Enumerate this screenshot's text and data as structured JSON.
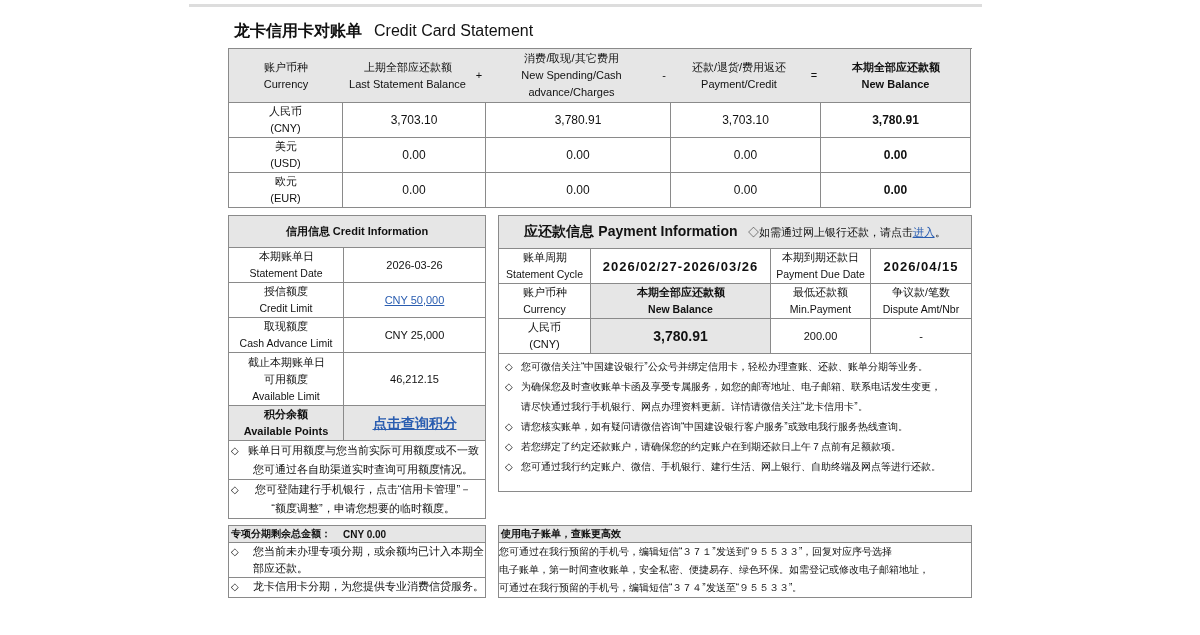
{
  "title": {
    "zh": "龙卡信用卡对账单",
    "en": "Credit Card Statement"
  },
  "summary": {
    "columns": [
      {
        "zh": "账户币种",
        "en": "Currency",
        "emphasis": false
      },
      {
        "zh": "上期全部应还款额",
        "en": "Last Statement Balance",
        "operator": "+",
        "emphasis": false
      },
      {
        "zh": "消费/取现/其它费用",
        "en": "New Spending/Cash advance/Charges",
        "operator": "-",
        "emphasis": false
      },
      {
        "zh": "还款/退货/费用返还",
        "en": "Payment/Credit",
        "operator": "=",
        "emphasis": false
      },
      {
        "zh": "本期全部应还款额",
        "en": "New Balance",
        "emphasis": true
      }
    ],
    "rows": [
      {
        "currency": "人民币",
        "code": "(CNY)",
        "values": [
          "3,703.10",
          "3,780.91",
          "3,703.10",
          "3,780.91"
        ]
      },
      {
        "currency": "美元",
        "code": "(USD)",
        "values": [
          "0.00",
          "0.00",
          "0.00",
          "0.00"
        ]
      },
      {
        "currency": "欧元",
        "code": "(EUR)",
        "values": [
          "0.00",
          "0.00",
          "0.00",
          "0.00"
        ]
      }
    ]
  },
  "credit": {
    "title": "信用信息 Credit Information",
    "rows": [
      {
        "label": [
          "本期账单日",
          "Statement Date"
        ],
        "value": "2026-03-26",
        "link": false,
        "highlight": false
      },
      {
        "label": [
          "授信额度",
          "Credit Limit"
        ],
        "value": "CNY 50,000",
        "link": true,
        "highlight": false
      },
      {
        "label": [
          "取现额度",
          "Cash Advance Limit"
        ],
        "value": "CNY 25,000",
        "link": false,
        "highlight": false
      },
      {
        "label": [
          "截止本期账单日",
          "可用额度",
          "Available Limit"
        ],
        "value": "46,212.15",
        "link": false,
        "highlight": false
      },
      {
        "label": [
          "积分余额",
          "Available Points"
        ],
        "value": "点击查询积分",
        "link": true,
        "highlight": true
      }
    ],
    "notes": [
      {
        "bullet": "◇",
        "lines": [
          "账单日可用额度与您当前实际可用额度或不一致",
          "您可通过各自助渠道实时查询可用额度情况。"
        ]
      },
      {
        "bullet": "◇",
        "lines": [
          "您可登陆建行手机银行，点击“信用卡管理”－",
          "“额度调整”，申请您想要的临时额度。"
        ]
      }
    ]
  },
  "payment": {
    "title": "应还款信息 Payment Information",
    "hint": {
      "text": "◇如需通过网上银行还款，请点击",
      "link": "进入",
      "end": "。"
    },
    "cycle": {
      "label": [
        "账单周期",
        "Statement Cycle"
      ],
      "value": "2026/02/27-2026/03/26"
    },
    "due": {
      "label": [
        "本期到期还款日",
        "Payment Due Date"
      ],
      "value": "2026/04/15"
    },
    "columns": [
      {
        "zh": "账户币种",
        "en": "Currency",
        "highlight": false
      },
      {
        "zh": "本期全部应还款额",
        "en": "New Balance",
        "highlight": true
      },
      {
        "zh": "最低还款额",
        "en": "Min.Payment",
        "highlight": false
      },
      {
        "zh": "争议款/笔数",
        "en": "Dispute Amt/Nbr",
        "highlight": false
      }
    ],
    "row": {
      "currency": [
        "人民币",
        "(CNY)"
      ],
      "values": [
        "3,780.91",
        "200.00",
        "-"
      ]
    },
    "notes": [
      {
        "bullet": "◇",
        "lines": [
          "您可微信关注“中国建设银行”公众号并绑定信用卡，轻松办理查账、还款、账单分期等业务。"
        ]
      },
      {
        "bullet": "◇",
        "lines": [
          "为确保您及时查收账单卡函及享受专属服务，如您的邮寄地址、电子邮箱、联系电话发生变更，",
          "请尽快通过我行手机银行、网点办理资料更新。详情请微信关注“龙卡信用卡”。"
        ]
      },
      {
        "bullet": "◇",
        "lines": [
          "请您核实账单，如有疑问请微信咨询“中国建设银行客户服务”或致电我行服务热线查询。"
        ]
      },
      {
        "bullet": "◇",
        "lines": [
          "若您绑定了约定还款账户，请确保您的约定账户在到期还款日上午７点前有足额款项。"
        ]
      },
      {
        "bullet": "◇",
        "lines": [
          "您可通过我行约定账户、微信、手机银行、建行生活、网上银行、自助终端及网点等进行还款。"
        ]
      }
    ]
  },
  "installment": {
    "title": "专项分期剩余总金额：",
    "amount": "CNY 0.00",
    "notes": [
      {
        "bullet": "◇",
        "lines": [
          "您当前未办理专项分期，或余额均已计入本期全",
          "部应还款。"
        ]
      },
      {
        "bullet": "◇",
        "lines": [
          "龙卡信用卡分期，为您提供专业消费信贷服务。"
        ]
      }
    ]
  },
  "ebill": {
    "title": "使用电子账单，查账更高效",
    "lines": [
      "您可通过在我行预留的手机号，编辑短信“３７１”发送到“９５５３３”，回复对应序号选择",
      "电子账单，第一时间查收账单，安全私密、便捷易存、绿色环保。如需登记或修改电子邮箱地址，",
      "可通过在我行预留的手机号，编辑短信“３７４”发送至“９５５３３”。"
    ]
  }
}
